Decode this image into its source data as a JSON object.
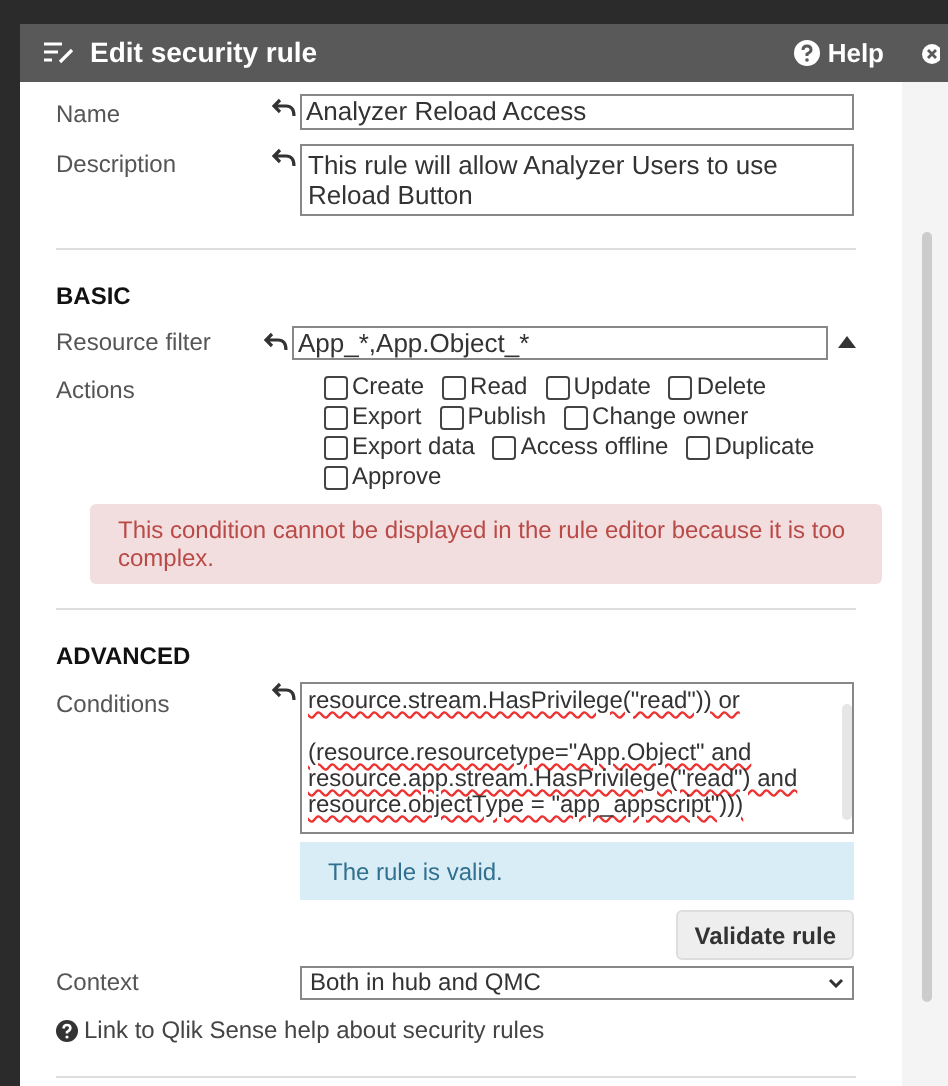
{
  "dialog": {
    "title": "Edit security rule",
    "help": "Help"
  },
  "fields": [
    {
      "label": "Name",
      "value": "Analyzer Reload Access",
      "kind": "input"
    },
    {
      "label": "Description",
      "value": "This rule will allow Analyzer Users to use Reload Button",
      "kind": "textarea"
    }
  ],
  "basic": {
    "heading": "BASIC",
    "resource_filter": {
      "label": "Resource filter",
      "value": "App_*,App.Object_*",
      "expanded": true
    },
    "actions": {
      "label": "Actions",
      "rows": [
        [
          {
            "label": "Create",
            "checked": false
          },
          {
            "label": "Read",
            "checked": false
          },
          {
            "label": "Update",
            "checked": false
          },
          {
            "label": "Delete",
            "checked": false
          }
        ],
        [
          {
            "label": "Export",
            "checked": false
          },
          {
            "label": "Publish",
            "checked": false
          },
          {
            "label": "Change owner",
            "checked": false
          }
        ],
        [
          {
            "label": "Export data",
            "checked": false
          },
          {
            "label": "Access offline",
            "checked": false
          },
          {
            "label": "Duplicate",
            "checked": false
          }
        ],
        [
          {
            "label": "Approve",
            "checked": false
          }
        ]
      ]
    },
    "error": "This condition cannot be displayed in the rule editor because it is too complex."
  },
  "advanced": {
    "heading": "ADVANCED",
    "conditions": {
      "label": "Conditions",
      "paragraphs": [
        [
          "resource.stream.HasPrivilege(\"read\")) or"
        ],
        [
          "(resource.resourcetype=\"App.Object\" and",
          "resource.app.stream.HasPrivilege(\"read\") and",
          "resource.objectType = \"app_appscript\")))"
        ]
      ]
    },
    "valid_message": "The rule is valid.",
    "validate_button": "Validate rule",
    "context": {
      "label": "Context",
      "value": "Both in hub and QMC"
    },
    "help_link": "Link to Qlik Sense help about security rules"
  }
}
